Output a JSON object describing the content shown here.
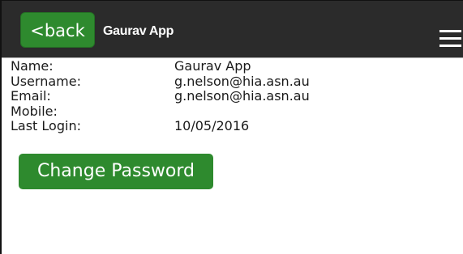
{
  "header": {
    "back_label": "<back",
    "title": "Gaurav App",
    "menu_icon": "hamburger-menu-icon"
  },
  "profile": {
    "rows": [
      {
        "label": "Name:",
        "value": "Gaurav App"
      },
      {
        "label": "Username:",
        "value": "g.nelson@hia.asn.au"
      },
      {
        "label": "Email:",
        "value": "g.nelson@hia.asn.au"
      },
      {
        "label": "Mobile:",
        "value": ""
      },
      {
        "label": "Last Login:",
        "value": "10/05/2016"
      }
    ]
  },
  "actions": {
    "change_password_label": "Change Password"
  },
  "colors": {
    "header_bg": "#2b2b2b",
    "button_green": "#2e8a2e",
    "text": "#1a1a1a"
  }
}
